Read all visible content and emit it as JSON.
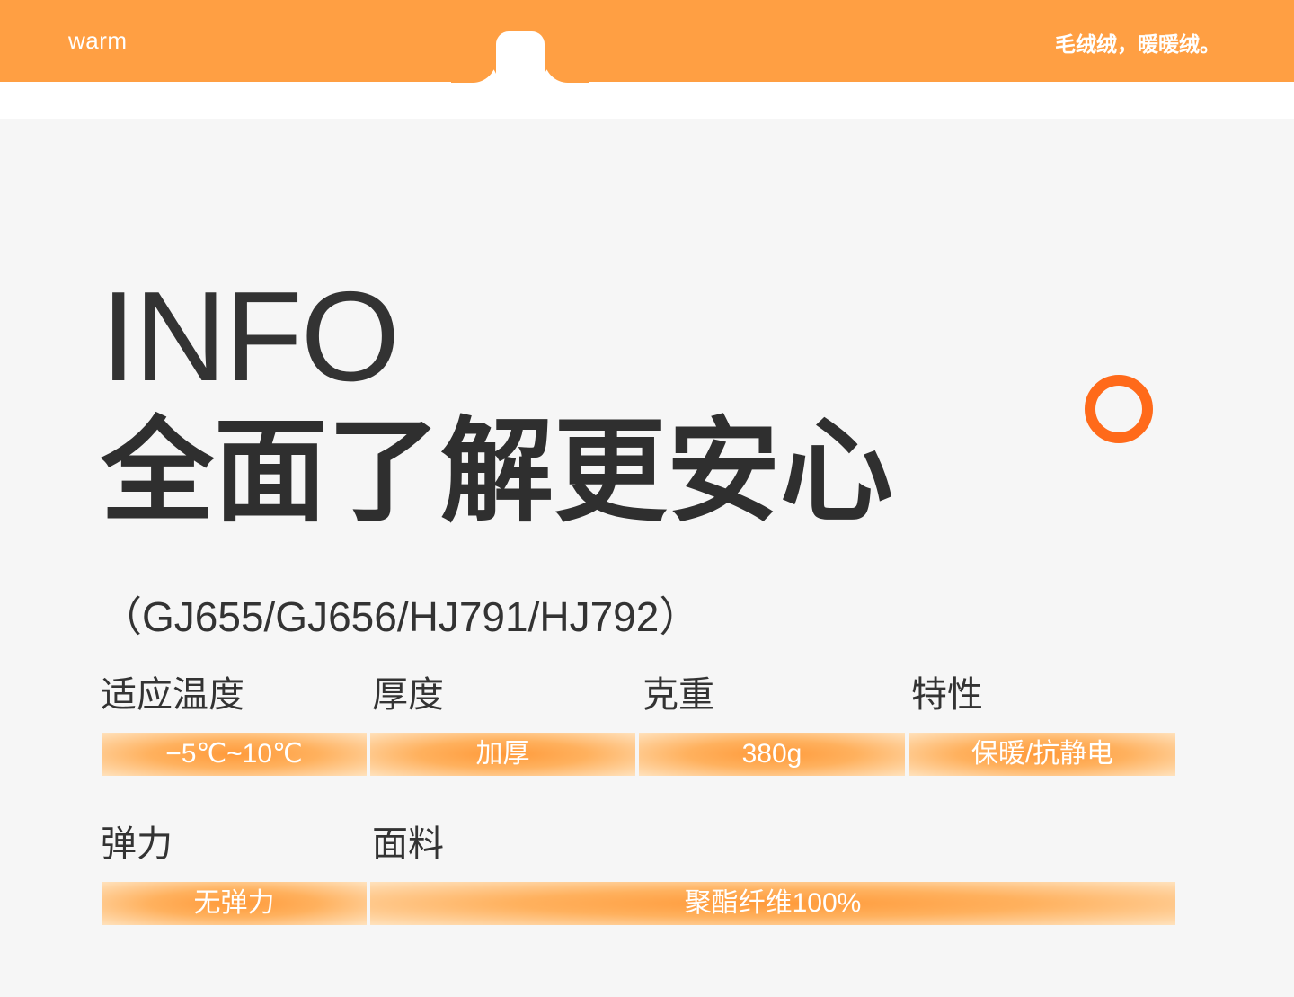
{
  "header": {
    "brand": "warm",
    "slogan": "毛绒绒，暖暖绒。"
  },
  "hero": {
    "title_en": "INFO",
    "title_cn": "全面了解更安心",
    "models": "（GJ655/GJ656/HJ791/HJ792）"
  },
  "specs": {
    "row1": [
      {
        "label": "适应温度",
        "value": "−5℃~10℃"
      },
      {
        "label": "厚度",
        "value": "加厚"
      },
      {
        "label": "克重",
        "value": "380g"
      },
      {
        "label": "特性",
        "value": "保暖/抗静电"
      }
    ],
    "row2": [
      {
        "label": "弹力",
        "value": "无弹力"
      },
      {
        "label": "面料",
        "value": "聚酯纤维100%"
      }
    ]
  },
  "colors": {
    "band": "#ff9f43",
    "ring": "#ff6a1a",
    "text": "#333333",
    "background": "#f6f6f6"
  }
}
